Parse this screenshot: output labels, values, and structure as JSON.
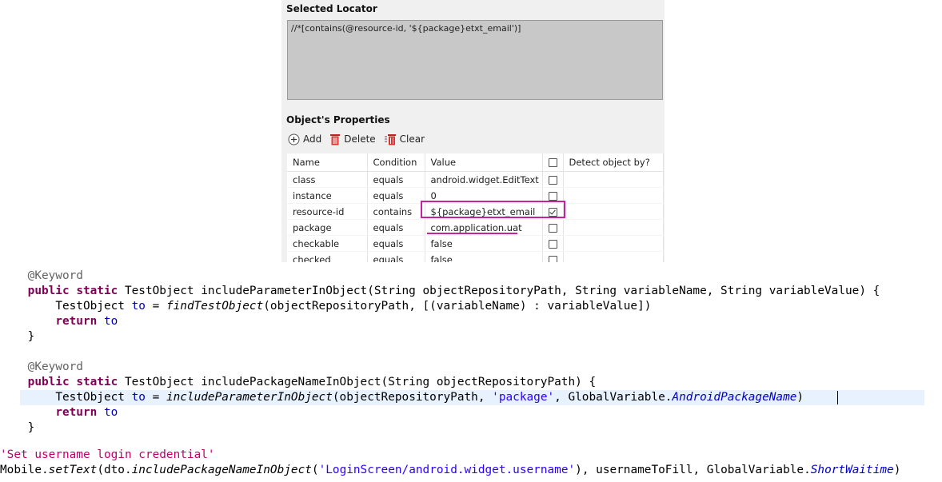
{
  "panel": {
    "selected_locator_title": "Selected Locator",
    "locator_value": "//*[contains(@resource-id, '${package}etxt_email')]",
    "properties_title": "Object's Properties",
    "toolbar": {
      "add": "Add",
      "delete": "Delete",
      "clear": "Clear"
    },
    "table": {
      "headers": {
        "name": "Name",
        "condition": "Condition",
        "value": "Value",
        "detect": "Detect object by?"
      },
      "rows": [
        {
          "name": "class",
          "condition": "equals",
          "value": "android.widget.EditText",
          "detect": false
        },
        {
          "name": "instance",
          "condition": "equals",
          "value": "0",
          "detect": false
        },
        {
          "name": "resource-id",
          "condition": "contains",
          "value": "${package}etxt_email",
          "detect": true
        },
        {
          "name": "package",
          "condition": "equals",
          "value": "com.application.uat",
          "detect": false
        },
        {
          "name": "checkable",
          "condition": "equals",
          "value": "false",
          "detect": false
        },
        {
          "name": "checked",
          "condition": "equals",
          "value": "false",
          "detect": false
        }
      ]
    },
    "highlight_color": "#c4239b"
  },
  "code": {
    "l1": {
      "a": "@Keyword"
    },
    "l2": {
      "kw1": "public",
      "kw2": "static",
      "rest": " TestObject includeParameterInObject(String objectRepositoryPath, String variableName, String variableValue) {"
    },
    "l3": {
      "a": "TestObject ",
      "b": "to",
      "c": " = ",
      "d": "findTestObject",
      "e": "(objectRepositoryPath, [(variableName) : variableValue])"
    },
    "l4": {
      "kw": "return",
      "b": "to"
    },
    "l5": {
      "a": "}"
    },
    "l6": {
      "a": "@Keyword"
    },
    "l7": {
      "kw1": "public",
      "kw2": "static",
      "rest": " TestObject includePackageNameInObject(String objectRepositoryPath) {"
    },
    "l8": {
      "a": "TestObject ",
      "b": "to",
      "c": " = ",
      "d": "includeParameterInObject",
      "e": "(objectRepositoryPath, ",
      "f": "'package'",
      "g": ", GlobalVariable.",
      "h": "AndroidPackageName",
      "i": ")"
    },
    "l9": {
      "kw": "return",
      "b": "to"
    },
    "l10": {
      "a": "}"
    },
    "l11": {
      "a": "'Set username login credential'"
    },
    "l12": {
      "a": "Mobile.",
      "b": "setText",
      "c": "(dto.",
      "d": "includePackageNameInObject",
      "e": "(",
      "f": "'LoginScreen/android.widget.username'",
      "g": "), ",
      "h": "usernameToFill",
      "i": ", GlobalVariable.",
      "j": "ShortWaitime",
      "k": ")"
    }
  },
  "colors": {
    "keyword": "#7f0055",
    "field": "#0000c0",
    "string": "#2a00ff",
    "annotation": "#646464",
    "current_line": "#e8f2fe"
  }
}
